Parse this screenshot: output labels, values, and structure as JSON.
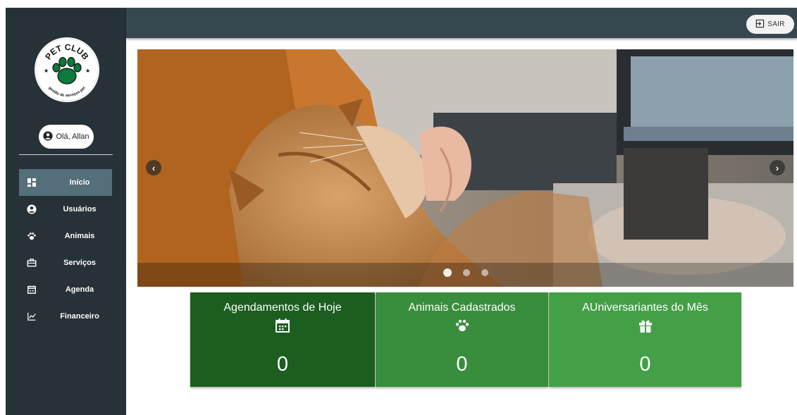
{
  "brand": {
    "logo_top_text": "PET CLUB",
    "logo_bottom_text": "gestão de serviços pet"
  },
  "user": {
    "greeting": "Olá, Allan"
  },
  "nav": [
    {
      "label": "Início",
      "icon": "dashboard-icon",
      "active": true
    },
    {
      "label": "Usuários",
      "icon": "user-circle-icon",
      "active": false
    },
    {
      "label": "Animais",
      "icon": "paw-icon",
      "active": false
    },
    {
      "label": "Serviços",
      "icon": "briefcase-icon",
      "active": false
    },
    {
      "label": "Agenda",
      "icon": "calendar-icon",
      "active": false
    },
    {
      "label": "Financeiro",
      "icon": "chart-line-icon",
      "active": false
    }
  ],
  "topbar": {
    "logout_label": "SAIR",
    "logout_icon": "logout-icon"
  },
  "carousel": {
    "slide_count": 3,
    "active_slide": 1
  },
  "cards": [
    {
      "title": "Agendamentos de Hoje",
      "icon": "calendar-icon",
      "value": "0",
      "color": "#1b5e20"
    },
    {
      "title": "Animais Cadastrados",
      "icon": "paw-icon",
      "value": "0",
      "color": "#388e3c"
    },
    {
      "title": "AUniversariantes do Mês",
      "icon": "gift-icon",
      "value": "0",
      "color": "#43a047"
    }
  ],
  "colors": {
    "sidebar": "#263238",
    "topbar": "#37474f",
    "nav_active": "#546e7a"
  }
}
